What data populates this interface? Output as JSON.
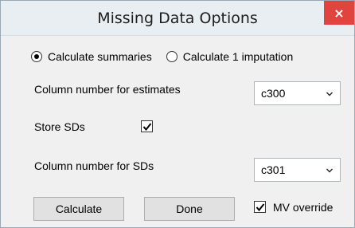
{
  "window": {
    "title": "Missing Data Options",
    "close_glyph": "×"
  },
  "mode": {
    "options": [
      {
        "label": "Calculate summaries",
        "checked": true
      },
      {
        "label": "Calculate 1 imputation",
        "checked": false
      }
    ]
  },
  "estimates": {
    "label": "Column number for estimates",
    "value": "c300"
  },
  "store_sds": {
    "label": "Store SDs",
    "checked": true
  },
  "sds": {
    "label": "Column number for SDs",
    "value": "c301"
  },
  "buttons": {
    "calculate": "Calculate",
    "done": "Done"
  },
  "mv_override": {
    "label": "MV override",
    "checked": true
  }
}
